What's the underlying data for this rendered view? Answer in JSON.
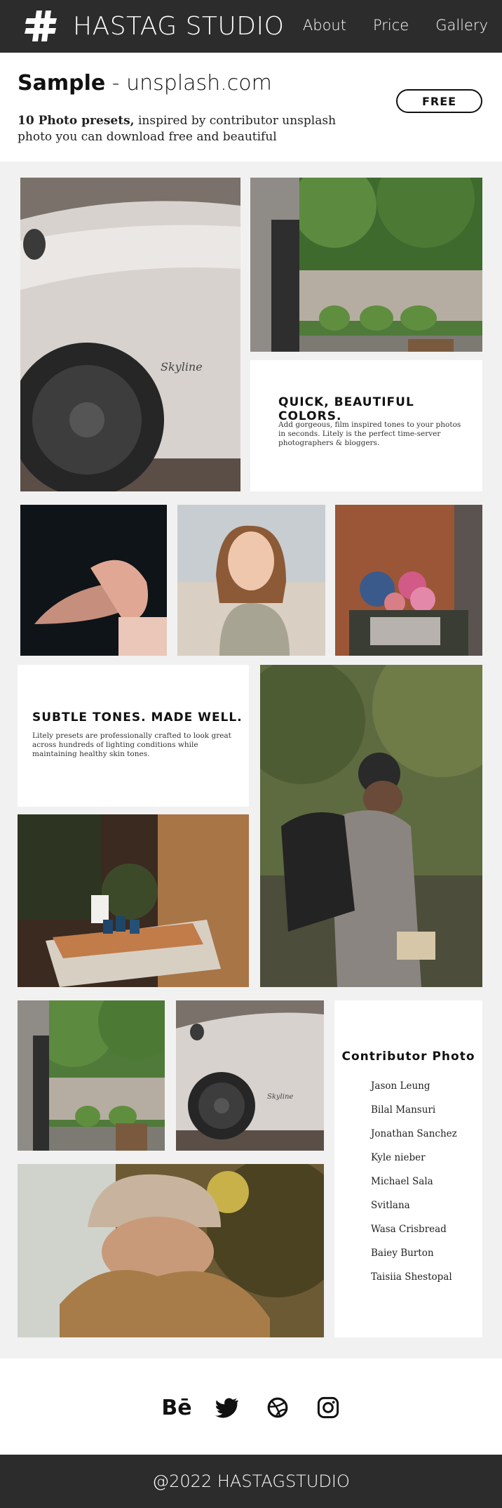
{
  "header": {
    "logo_text": "HASTAG STUDIO",
    "nav": [
      "About",
      "Price",
      "Gallery"
    ]
  },
  "intro": {
    "title_bold": "Sample",
    "title_rest": " - unsplash.com",
    "desc_bold": "10 Photo presets,",
    "desc_rest": " inspired by contributor unsplash photo you can download free and beautiful",
    "free_label": "FREE"
  },
  "cards": {
    "quick_title": "QUICK, BEAUTIFUL COLORS.",
    "quick_text": "Add gorgeous, film inspired tones to your photos in seconds. Litely is the perfect time-server photographers & bloggers.",
    "subtle_title": "SUBTLE TONES. MADE WELL.",
    "subtle_text": "Litely presets are professionally crafted to look great across hundreds of lighting conditions while maintaining healthy skin tones."
  },
  "contributors": {
    "title": "Contributor Photo",
    "names": [
      "Jason Leung",
      "Bilal Mansuri",
      "Jonathan Sanchez",
      "Kyle nieber",
      "Michael Sala",
      "Svitlana",
      "Wasa Crisbread",
      "Baiey Burton",
      "Taisiia Shestopal"
    ]
  },
  "social": {
    "icons": [
      "behance-icon",
      "twitter-icon",
      "dribbble-icon",
      "instagram-icon"
    ],
    "behance_label": "Bē"
  },
  "footer": {
    "copyright": "@2022 HASTAGSTUDIO"
  },
  "colors": {
    "header_bg": "#2c2c2c",
    "page_bg": "#f1f1f1",
    "card_bg": "#ffffff"
  }
}
